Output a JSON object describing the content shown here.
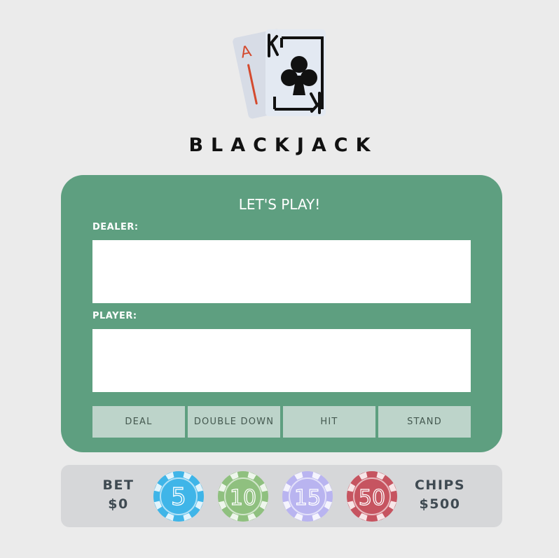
{
  "title": "BLACKJACK",
  "board": {
    "heading": "LET'S PLAY!",
    "dealer_label": "DEALER:",
    "player_label": "PLAYER:"
  },
  "actions": {
    "deal": "DEAL",
    "double_down": "DOUBLE DOWN",
    "hit": "HIT",
    "stand": "STAND"
  },
  "bet": {
    "label": "BET",
    "value": "$0"
  },
  "chips_total": {
    "label": "CHIPS",
    "value": "$500"
  },
  "chips": [
    {
      "value": "5",
      "color": "#3fb5e8"
    },
    {
      "value": "10",
      "color": "#8fc07f"
    },
    {
      "value": "15",
      "color": "#b9b4f0"
    },
    {
      "value": "50",
      "color": "#c65460"
    }
  ],
  "logo_cards": {
    "back_rank": "A",
    "front_rank": "K",
    "front_suit": "club-icon"
  },
  "colors": {
    "background": "#ebebeb",
    "table_felt": "#5e9f80",
    "button": "#bdd4ca",
    "bottom_bar": "#d6d7d9",
    "ace_red": "#d44a2e"
  }
}
